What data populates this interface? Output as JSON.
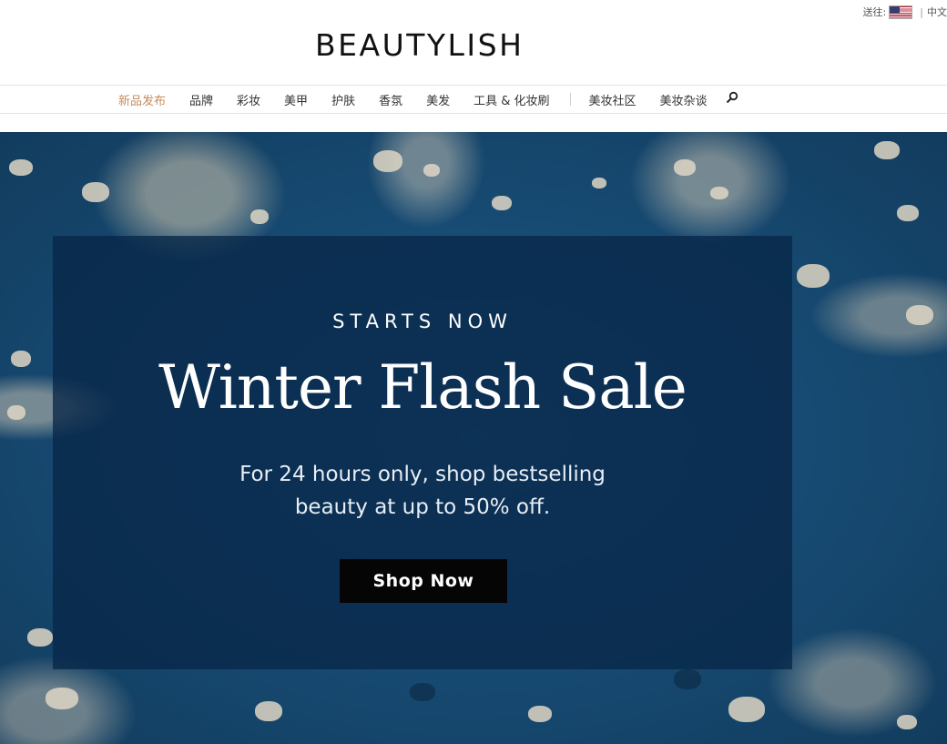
{
  "util": {
    "ship_label": "送往:",
    "separator": "|",
    "language": "中文"
  },
  "logo": {
    "text": "BEAUTYLISH"
  },
  "nav": {
    "items": [
      {
        "label": "新品发布",
        "active": true
      },
      {
        "label": "品牌"
      },
      {
        "label": "彩妆"
      },
      {
        "label": "美甲"
      },
      {
        "label": "护肤"
      },
      {
        "label": "香氛"
      },
      {
        "label": "美发"
      },
      {
        "label": "工具 & 化妆刷"
      }
    ],
    "secondary": [
      {
        "label": "美妆社区"
      },
      {
        "label": "美妆杂谈"
      }
    ],
    "search_icon": "search-icon"
  },
  "hero": {
    "eyebrow": "STARTS NOW",
    "headline": "Winter Flash Sale",
    "subcopy_line1": "For 24 hours only, shop bestselling",
    "subcopy_line2": "beauty at up to 50% off.",
    "cta": "Shop Now"
  },
  "colors": {
    "accent_nav_active": "#c48c5a",
    "hero_blue": "#1f5a86",
    "overlay": "#082648",
    "cta_bg": "#050505"
  }
}
